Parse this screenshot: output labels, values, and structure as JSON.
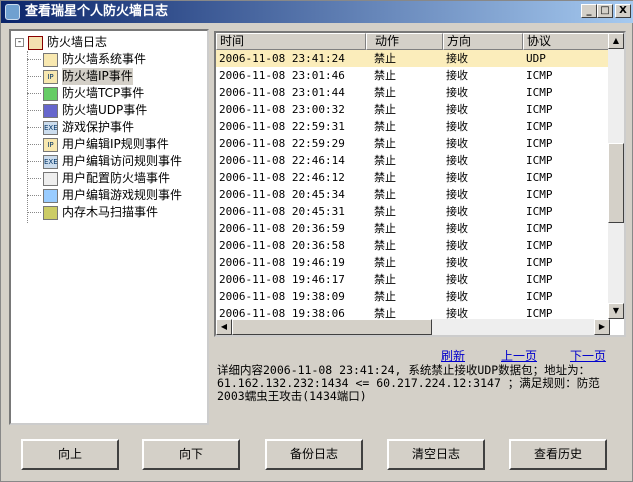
{
  "window": {
    "title": "查看瑞星个人防火墙日志",
    "minimize": "_",
    "maximize": "□",
    "close": "X"
  },
  "tree": {
    "root": "防火墙日志",
    "items": [
      {
        "label": "防火墙系统事件",
        "icon": "document-icon",
        "glyph": ""
      },
      {
        "label": "防火墙IP事件",
        "icon": "ip-icon",
        "glyph": "IP"
      },
      {
        "label": "防火墙TCP事件",
        "icon": "computer-icon",
        "glyph": ""
      },
      {
        "label": "防火墙UDP事件",
        "icon": "computer-icon",
        "glyph": ""
      },
      {
        "label": "游戏保护事件",
        "icon": "exe-icon",
        "glyph": "EXE"
      },
      {
        "label": "用户编辑IP规则事件",
        "icon": "ip-rule-icon",
        "glyph": "IP"
      },
      {
        "label": "用户编辑访问规则事件",
        "icon": "exe-rule-icon",
        "glyph": "EXE"
      },
      {
        "label": "用户配置防火墙事件",
        "icon": "config-icon",
        "glyph": ""
      },
      {
        "label": "用户编辑游戏规则事件",
        "icon": "game-rule-icon",
        "glyph": ""
      },
      {
        "label": "内存木马扫描事件",
        "icon": "scan-icon",
        "glyph": ""
      }
    ],
    "selected": 1
  },
  "table": {
    "columns": [
      "时间",
      "动作",
      "方向",
      "协议"
    ],
    "rows": [
      [
        "2006-11-08 23:41:24",
        "禁止",
        "接收",
        "UDP"
      ],
      [
        "2006-11-08 23:01:46",
        "禁止",
        "接收",
        "ICMP"
      ],
      [
        "2006-11-08 23:01:44",
        "禁止",
        "接收",
        "ICMP"
      ],
      [
        "2006-11-08 23:00:32",
        "禁止",
        "接收",
        "ICMP"
      ],
      [
        "2006-11-08 22:59:31",
        "禁止",
        "接收",
        "ICMP"
      ],
      [
        "2006-11-08 22:59:29",
        "禁止",
        "接收",
        "ICMP"
      ],
      [
        "2006-11-08 22:46:14",
        "禁止",
        "接收",
        "ICMP"
      ],
      [
        "2006-11-08 22:46:12",
        "禁止",
        "接收",
        "ICMP"
      ],
      [
        "2006-11-08 20:45:34",
        "禁止",
        "接收",
        "ICMP"
      ],
      [
        "2006-11-08 20:45:31",
        "禁止",
        "接收",
        "ICMP"
      ],
      [
        "2006-11-08 20:36:59",
        "禁止",
        "接收",
        "ICMP"
      ],
      [
        "2006-11-08 20:36:58",
        "禁止",
        "接收",
        "ICMP"
      ],
      [
        "2006-11-08 19:46:19",
        "禁止",
        "接收",
        "ICMP"
      ],
      [
        "2006-11-08 19:46:17",
        "禁止",
        "接收",
        "ICMP"
      ],
      [
        "2006-11-08 19:38:09",
        "禁止",
        "接收",
        "ICMP"
      ],
      [
        "2006-11-08 19:38:06",
        "禁止",
        "接收",
        "ICMP"
      ]
    ]
  },
  "links": {
    "refresh": "刷新",
    "prev": "上一页",
    "next": "下一页"
  },
  "detail": "详细内容2006-11-08 23:41:24, 系统禁止接收UDP数据包；地址为：61.162.132.232:1434 <= 60.217.224.12:3147 ；满足规则：防范2003蠕虫王攻击(1434端口)",
  "buttons": [
    "向上",
    "向下",
    "备份日志",
    "清空日志",
    "查看历史"
  ]
}
